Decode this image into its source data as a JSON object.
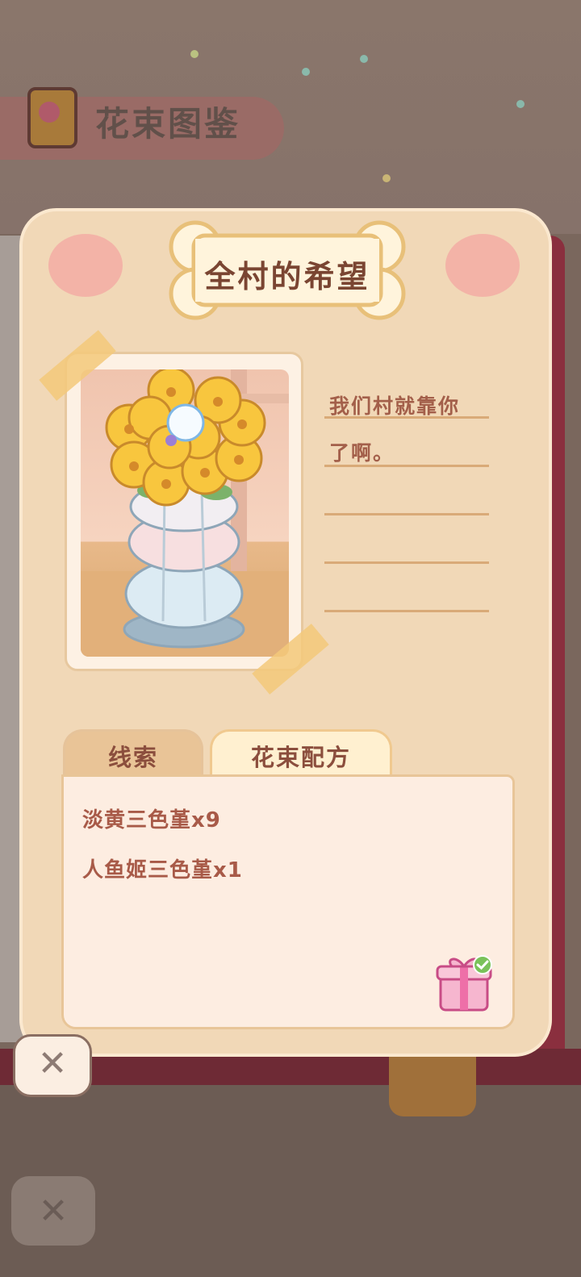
{
  "background": {
    "album_title": "花束图鉴",
    "close_icon": "close-icon"
  },
  "card": {
    "title": "全村的希望",
    "quote_lines": [
      "我们村就靠你",
      "了啊。",
      "",
      "",
      ""
    ]
  },
  "tabs": {
    "clues": "线索",
    "recipe": "花束配方",
    "active": "recipe"
  },
  "recipe": {
    "ingredients": [
      "淡黄三色堇x9",
      "人鱼姬三色堇x1"
    ]
  },
  "icons": {
    "gift": "gift-icon",
    "check": "check-icon",
    "close": "close-icon"
  },
  "colors": {
    "card_bg": "#f1d8b7",
    "accent_text": "#7a4532",
    "ingredient_text": "#a85a48",
    "check_green": "#7ac25a"
  }
}
